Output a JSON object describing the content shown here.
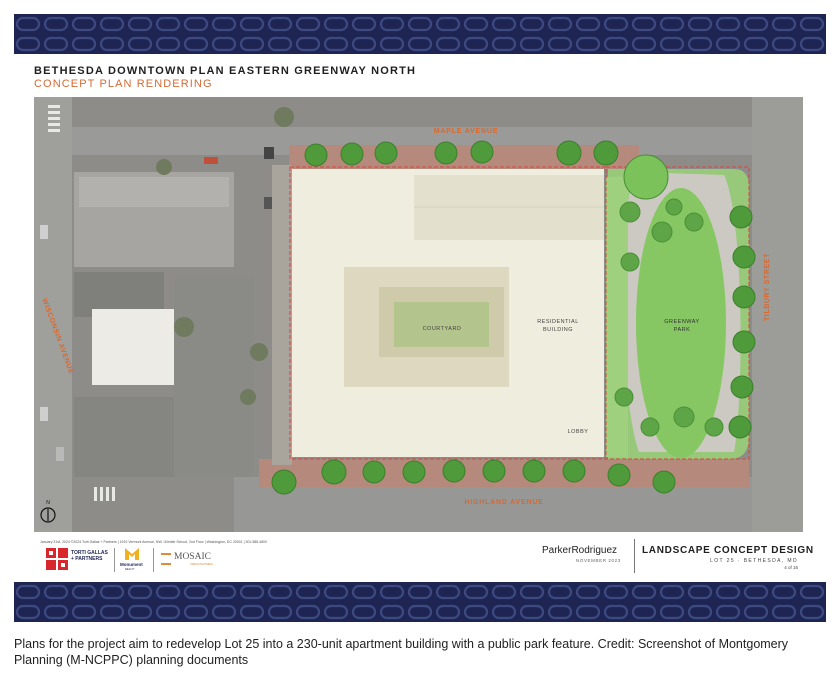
{
  "sheet": {
    "title": "BETHESDA DOWNTOWN PLAN EASTERN GREENWAY NORTH",
    "subtitle": "CONCEPT PLAN RENDERING"
  },
  "map": {
    "streets": {
      "maple": "MAPLE AVENUE",
      "highland": "HIGHLAND AVENUE",
      "wisconsin": "WISCONSIN AVENUE",
      "tilbury": "TILBURY STREET"
    },
    "labels": {
      "courtyard": "COURTYARD",
      "residential_line1": "RESIDENTIAL",
      "residential_line2": "BUILDING",
      "greenway_line1": "GREENWAY",
      "greenway_line2": "PARK",
      "lobby": "LOBBY"
    },
    "north_arrow": "N"
  },
  "footer": {
    "fine_print": "January 31st, 2024   ©2024 Torti Gallas + Partners | 1919 Vermont Avenue, NW, Gilmble School, 2nd Floor | Washington, DC 20001 | 301.588.4800",
    "torti_logo": "TORTI GALLAS + PARTNERS",
    "monument_logo": "Monument",
    "monument_sub": "REALTY",
    "mosaic_logo": "MOSAIC",
    "mosaic_sub": "URBAN PARTNERS",
    "firm": "ParkerRodriguez",
    "date": "NOVEMBER 2023",
    "sheet_title": "LANDSCAPE CONCEPT DESIGN",
    "project": "LOT 25 · BETHESDA, MD",
    "page": "4 of 16"
  },
  "caption": "Plans for the project aim to redevelop Lot 25 into a 230-unit apartment building with a public park feature. Credit: Screenshot of Montgomery Planning (M-NCPPC) planning documents",
  "colors": {
    "band": "#1e2552",
    "accent": "#d56a33",
    "building": "#efedde",
    "lawn": "#8fca6a",
    "sidewalk": "#b58a7c",
    "aerial": "#8a8a88"
  }
}
